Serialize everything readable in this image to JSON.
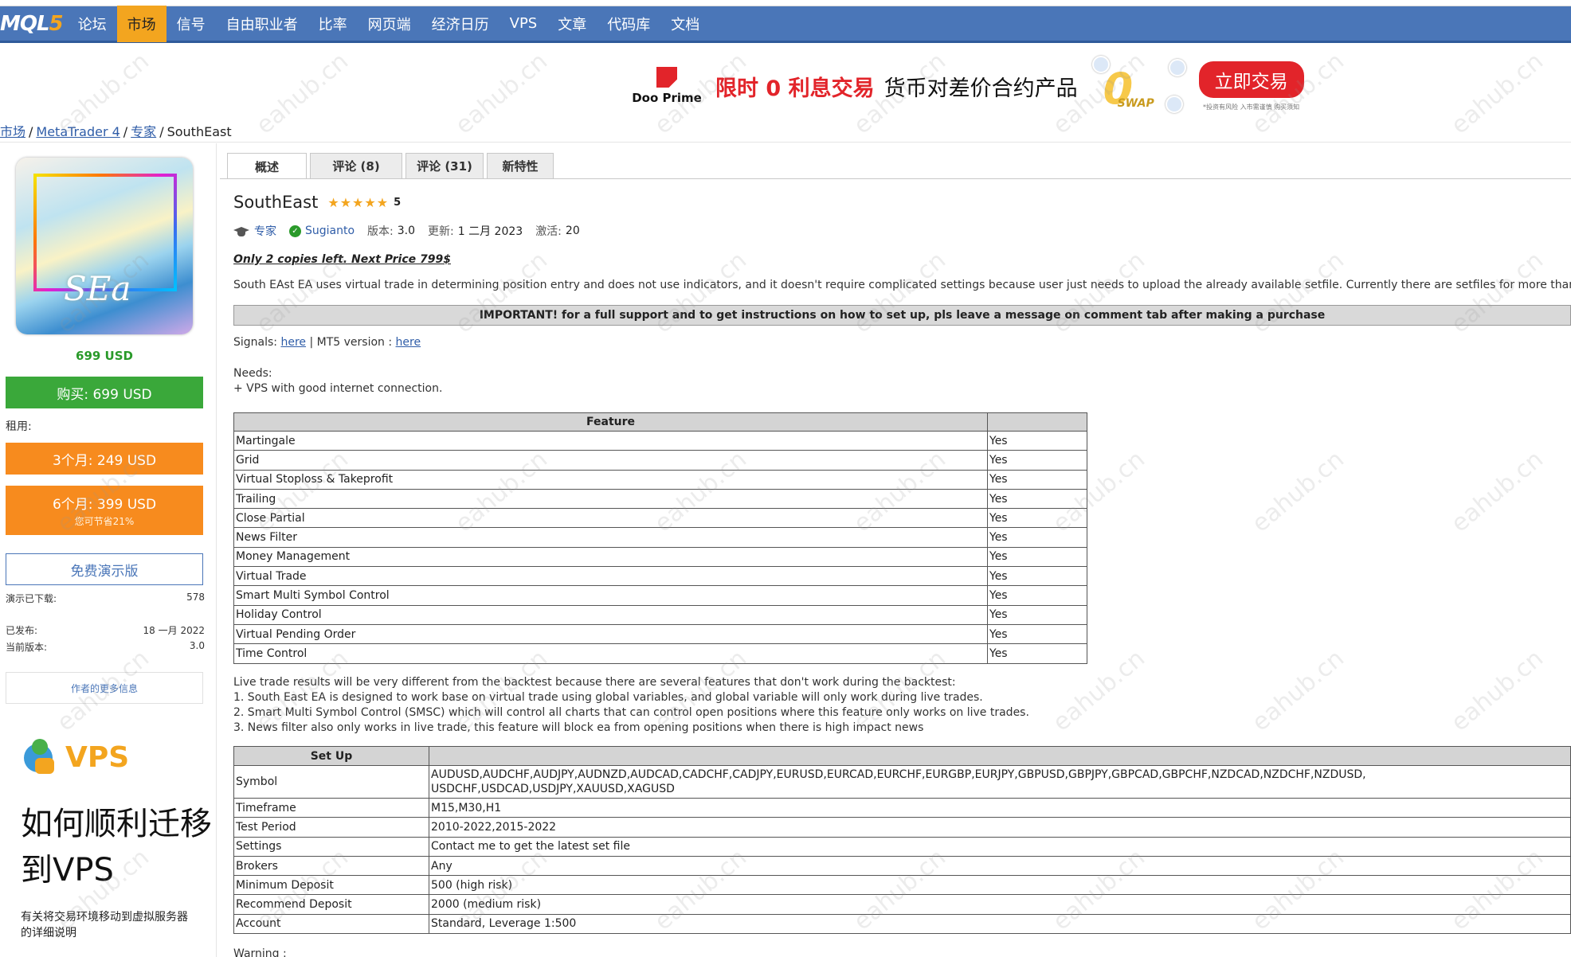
{
  "nav": {
    "logo_mql": "MQL",
    "logo_five": "5",
    "items": [
      "论坛",
      "市场",
      "信号",
      "自由职业者",
      "比率",
      "网页端",
      "经济日历",
      "VPS",
      "文章",
      "代码库",
      "文档"
    ],
    "active_index": 1
  },
  "banner": {
    "brand": "Doo Prime",
    "headline_red": "限时 0 利息交易",
    "headline_dark": "货币对差价合约产品",
    "art_zero": "0",
    "art_swap": "SWAP",
    "cta": "立即交易",
    "note": "*投资有风险 入市需谨慎 购买须知"
  },
  "breadcrumb": {
    "items": [
      "市场",
      "MetaTrader 4",
      "专家"
    ],
    "current": "SouthEast",
    "separator": "/"
  },
  "sidebar": {
    "image_signature": "SEa",
    "price": "699 USD",
    "buy": "购买: 699 USD",
    "rent_label": "租用:",
    "rent_3m": "3个月: 249 USD",
    "rent_6m": "6个月: 399 USD",
    "rent_6m_save": "您可节省21%",
    "demo": "免费演示版",
    "stats": [
      {
        "label": "演示已下载:",
        "value": "578"
      },
      {
        "label": "已发布:",
        "value": "18 一月 2022"
      },
      {
        "label": "当前版本:",
        "value": "3.0"
      }
    ],
    "more_info": "作者的更多信息",
    "vps_label": "VPS",
    "vps_heading": "如何顺利迁移到VPS",
    "vps_desc": "有关将交易环境移动到虚拟服务器的详细说明"
  },
  "tabs": [
    "概述",
    "评论 (8)",
    "评论 (31)",
    "新特性"
  ],
  "product": {
    "title": "SouthEast",
    "stars": "★★★★★",
    "rating": "5",
    "category": "专家",
    "author": "Sugianto",
    "version_label": "版本:",
    "version": "3.0",
    "updated_label": "更新:",
    "updated": "1 二月 2023",
    "activations_label": "激活:",
    "activations": "20",
    "promo": "Only 2 copies left.  Next Price 799$",
    "description": "South EAst EA uses virtual trade in determining position entry and does not use indicators, and it doesn't require complicated settings because user just needs to upload the already available setfile. Currently there are setfiles for more than",
    "important": "IMPORTANT! for a full support and to get instructions on how to set up, pls leave a message on comment tab after making a purchase",
    "signals_label": "Signals:",
    "signals_link": "here",
    "mt5_label": "MT5 version :",
    "mt5_link": "here",
    "needs_title": "Needs:",
    "needs_item": "+ VPS with good internet connection."
  },
  "feature_table": {
    "headers": [
      "Feature",
      ""
    ],
    "rows": [
      [
        "Martingale",
        "Yes"
      ],
      [
        "Grid",
        "Yes"
      ],
      [
        "Virtual Stoploss & Takeprofit",
        "Yes"
      ],
      [
        "Trailing",
        "Yes"
      ],
      [
        "Close Partial",
        "Yes"
      ],
      [
        "News Filter",
        "Yes"
      ],
      [
        "Money Management",
        "Yes"
      ],
      [
        "Virtual Trade",
        "Yes"
      ],
      [
        "Smart Multi Symbol Control",
        "Yes"
      ],
      [
        "Holiday Control",
        "Yes"
      ],
      [
        "Virtual Pending Order",
        "Yes"
      ],
      [
        "Time Control",
        "Yes"
      ]
    ]
  },
  "live_notes": [
    "Live trade results will be very different from the backtest because there are several features that don't work during the backtest:",
    "1. South East EA is designed to work base on virtual trade using global variables, and global variable will only work during live trades.",
    "2. Smart Multi Symbol Control (SMSC) which will control all charts that can control open positions where this feature only works on live trades.",
    "3. News filter also only works in live trade, this feature will block ea from opening positions when there is high impact news"
  ],
  "setup_table": {
    "headers": [
      "Set Up",
      ""
    ],
    "rows": [
      [
        "Symbol",
        "AUDUSD,AUDCHF,AUDJPY,AUDNZD,AUDCAD,CADCHF,CADJPY,EURUSD,EURCAD,EURCHF,EURGBP,EURJPY,GBPUSD,GBPJPY,GBPCAD,GBPCHF,NZDCAD,NZDCHF,NZDUSD, USDCHF,USDCAD,USDJPY,XAUUSD,XAGUSD"
      ],
      [
        "Timeframe",
        "M15,M30,H1"
      ],
      [
        "Test Period",
        "2010-2022,2015-2022"
      ],
      [
        "Settings",
        "Contact me to get the latest set file"
      ],
      [
        "Brokers",
        "Any"
      ],
      [
        "Minimum Deposit",
        "500 (high risk)"
      ],
      [
        "Recommend Deposit",
        "2000 (medium risk)"
      ],
      [
        "Account",
        "Standard, Leverage 1:500"
      ]
    ]
  },
  "warning": "Warning :",
  "watermark": "eahub.cn"
}
